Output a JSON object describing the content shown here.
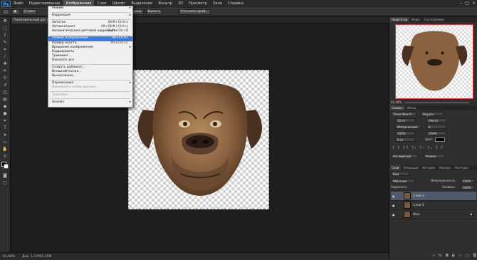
{
  "app": {
    "logo": "Ps"
  },
  "menubar": {
    "items": [
      "Файл",
      "Редактирование",
      "Изображение",
      "Слои",
      "Шрифт",
      "Выделение",
      "Фильтр",
      "3D",
      "Просмотр",
      "Окно",
      "Справка"
    ],
    "active_index": 2
  },
  "window_controls": {
    "minimize": "–",
    "maximize": "□",
    "close": "×"
  },
  "options_bar": {
    "feather": "0 пикс",
    "style": "Обычный",
    "width": "Ширина",
    "height": "Высота",
    "refine": "Уточнить край..."
  },
  "document": {
    "tab_title": "Помолдельный дог @ 91,..."
  },
  "image_menu": {
    "items": [
      {
        "label": "Режим",
        "shortcut": "",
        "submenu": true
      },
      {
        "sep": true
      },
      {
        "label": "Коррекция",
        "shortcut": "",
        "submenu": true
      },
      {
        "sep": true
      },
      {
        "label": "Автотон",
        "shortcut": "Shift+Ctrl+L"
      },
      {
        "label": "Автоконтраст",
        "shortcut": "Alt+Shift+Ctrl+L"
      },
      {
        "label": "Автоматическая цветовая коррекция",
        "shortcut": "Shift+Ctrl+B"
      },
      {
        "sep": true
      },
      {
        "label": "Размер изображения...",
        "shortcut": "Alt+Ctrl+I",
        "highlight": true
      },
      {
        "label": "Размер холста...",
        "shortcut": "Alt+Ctrl+C"
      },
      {
        "label": "Вращение изображения",
        "shortcut": "",
        "submenu": true
      },
      {
        "label": "Кадрировать",
        "shortcut": ""
      },
      {
        "label": "Тримминг...",
        "shortcut": ""
      },
      {
        "label": "Показать все",
        "shortcut": ""
      },
      {
        "sep": true
      },
      {
        "label": "Создать дубликат...",
        "shortcut": ""
      },
      {
        "label": "Внешний канал...",
        "shortcut": ""
      },
      {
        "label": "Вычисления...",
        "shortcut": ""
      },
      {
        "sep": true
      },
      {
        "label": "Переменные",
        "shortcut": "",
        "submenu": true
      },
      {
        "label": "Применить набор данных...",
        "shortcut": "",
        "disabled": true
      },
      {
        "sep": true
      },
      {
        "label": "Треппинг...",
        "shortcut": "",
        "disabled": true
      },
      {
        "sep": true
      },
      {
        "label": "Анализ",
        "shortcut": "",
        "submenu": true
      }
    ]
  },
  "statusbar": {
    "zoom": "91,48%",
    "doc": "Док: 1,37M/3,45M"
  },
  "navigator": {
    "tabs": [
      "Навигатор",
      "Инфо",
      "Гистограмма"
    ],
    "zoom": "91,48%"
  },
  "character": {
    "tabs": [
      "Символ",
      "Абзац"
    ],
    "font": "Times New R...",
    "style": "Regular",
    "size": "12 пт",
    "leading": "(Авто)",
    "kerning": "Метрический",
    "tracking": "0",
    "scale_v": "100%",
    "scale_h": "100%",
    "baseline": "0 пт",
    "color_label": "Цвет:",
    "lang": "Английский",
    "aa": "Резкое"
  },
  "layers": {
    "tabs": [
      "Слои",
      "Операции",
      "История",
      "Каналы",
      "Контуры"
    ],
    "kind": "Вид",
    "blend": "Обычные",
    "opacity_label": "Непрозрачность:",
    "opacity": "100%",
    "lock_label": "Закрепить:",
    "fill_label": "Заливка:",
    "fill": "100%",
    "items": [
      {
        "name": "Слой 2",
        "selected": true
      },
      {
        "name": "Слой 1",
        "selected": false
      },
      {
        "name": "Фон",
        "selected": false
      }
    ]
  },
  "colors": {
    "accent": "#3b7be0",
    "menu_bg": "#f0f0f0",
    "workspace": "#1e1e1e"
  }
}
